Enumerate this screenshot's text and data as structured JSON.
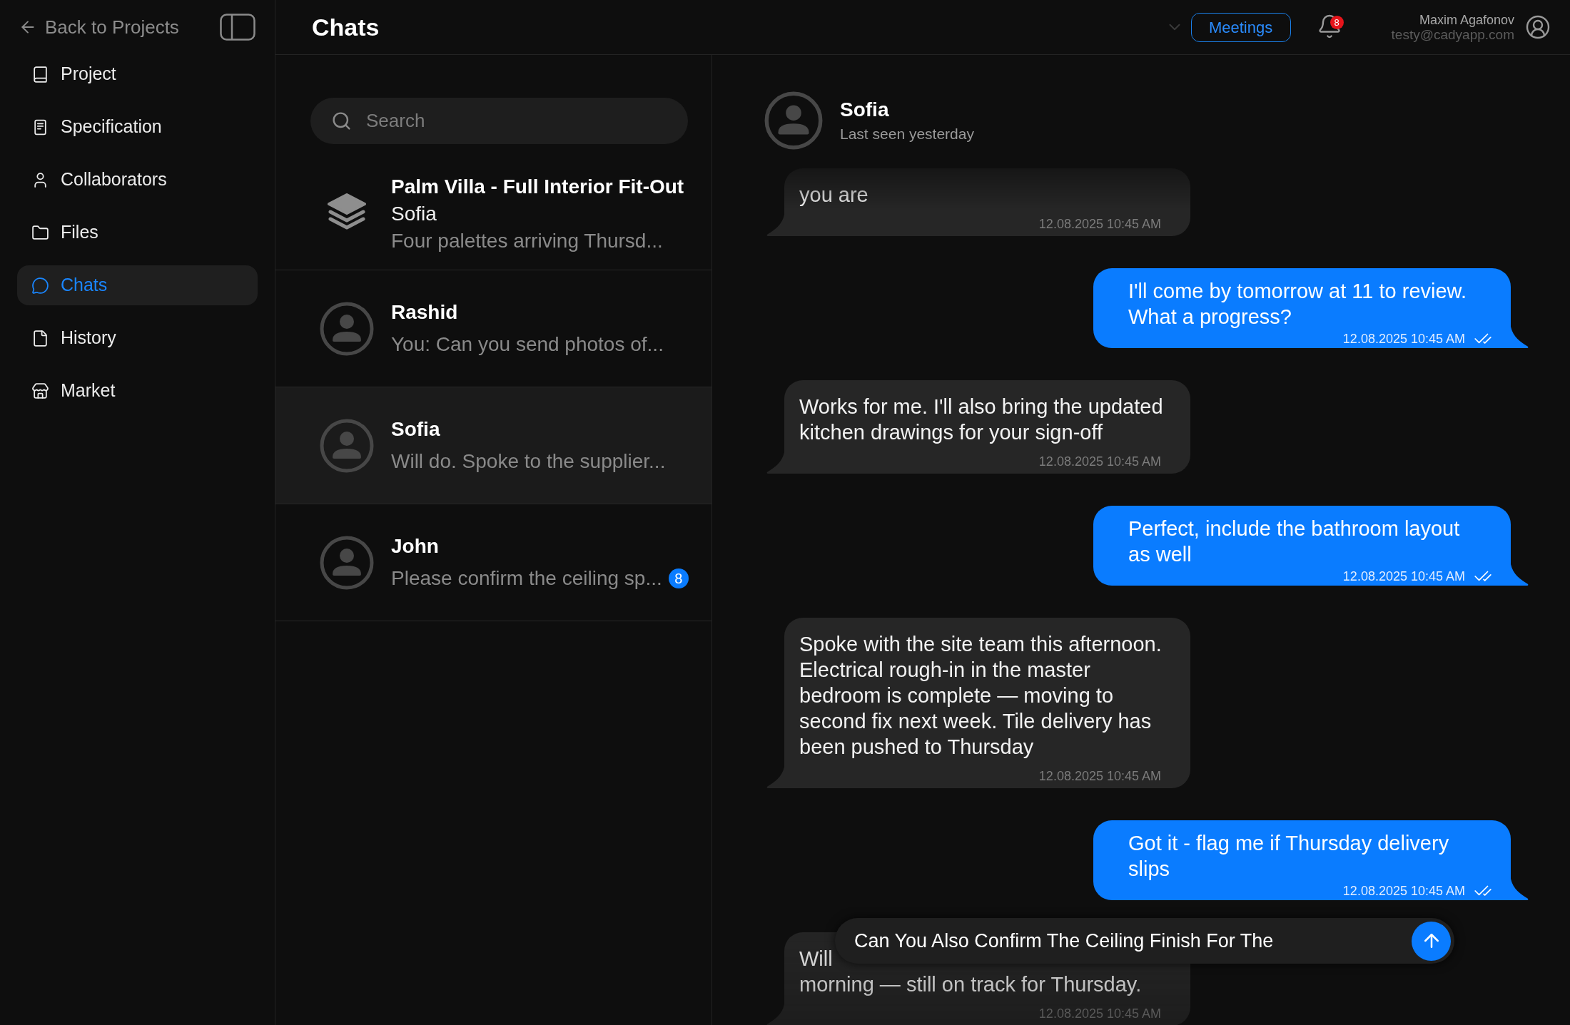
{
  "sidebar": {
    "back_link": "Back to Projects",
    "nav_items": [
      {
        "label": "Project",
        "selected": false
      },
      {
        "label": "Specification",
        "selected": false
      },
      {
        "label": "Collaborators",
        "selected": false
      },
      {
        "label": "Files",
        "selected": false
      },
      {
        "label": "Chats",
        "selected": true
      },
      {
        "label": "History",
        "selected": false
      },
      {
        "label": "Market",
        "selected": false
      }
    ]
  },
  "header": {
    "title": "Chats",
    "meetings_button": "Meetings",
    "notification_count": "8",
    "user": {
      "name": "Maxim Agafonov",
      "email": "testy@cadyapp.com"
    }
  },
  "chat_list": {
    "search": {
      "placeholder": "Search"
    },
    "items": [
      {
        "kind": "group",
        "title": "Palm Villa - Full Interior Fit-Out",
        "sender": "Sofia",
        "preview": "Four palettes arriving Thursd...",
        "selected": false
      },
      {
        "kind": "person",
        "name": "Rashid",
        "preview": "You: Can you send photos of...",
        "selected": false
      },
      {
        "kind": "person",
        "name": "Sofia",
        "preview": "Will do. Spoke to the supplier...",
        "selected": true
      },
      {
        "kind": "person",
        "name": "John",
        "preview": "Please confirm the ceiling sp...",
        "unread": "8",
        "selected": false
      }
    ]
  },
  "conversation": {
    "contact": {
      "name": "Sofia",
      "status": "Last seen yesterday"
    },
    "messages": [
      {
        "kind": "incoming",
        "lines": [
          "you are"
        ],
        "time": "12.08.2025 10:45 AM"
      },
      {
        "kind": "outgoing",
        "lines": [
          "I'll come by tomorrow at 11 to review.",
          "What a progress?"
        ],
        "time": "12.08.2025 10:45 AM",
        "read": true
      },
      {
        "kind": "incoming",
        "lines": [
          "Works for me. I'll also bring the updated",
          "kitchen drawings for your sign-off"
        ],
        "time": "12.08.2025 10:45 AM"
      },
      {
        "kind": "outgoing",
        "lines": [
          "Perfect, include the bathroom layout",
          "as well"
        ],
        "time": "12.08.2025 10:45 AM",
        "read": true
      },
      {
        "kind": "incoming",
        "lines": [
          "Spoke with the site team this afternoon.",
          "Electrical rough-in in the master",
          "bedroom is complete — moving to",
          "second fix next week. Tile delivery has",
          "been pushed to Thursday"
        ],
        "time": "12.08.2025 10:45 AM"
      },
      {
        "kind": "outgoing",
        "lines": [
          "Got it - flag me if Thursday delivery",
          "slips"
        ],
        "time": "12.08.2025 10:45 AM",
        "read": true
      },
      {
        "kind": "incoming",
        "lines": [
          "Will",
          "morning — still on track for Thursday."
        ],
        "time": "12.08.2025 10:45 AM"
      }
    ],
    "composer": {
      "value": "Can You Also Confirm The Ceiling Finish For The"
    }
  }
}
